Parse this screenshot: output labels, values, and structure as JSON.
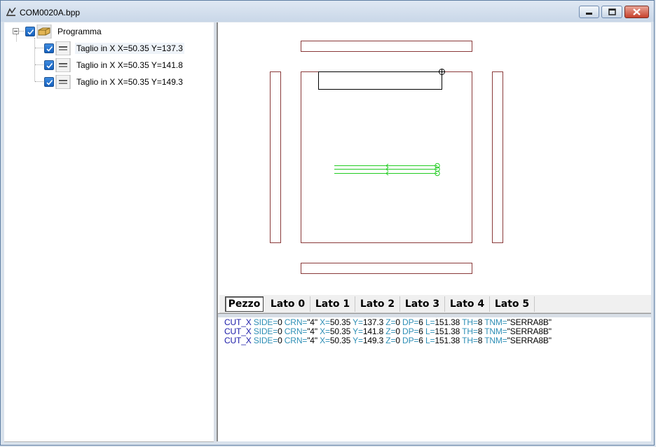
{
  "window": {
    "title": "COM0020A.bpp",
    "controls": [
      "minimize-button",
      "maximize-button",
      "close-button"
    ]
  },
  "tree": {
    "root": {
      "label": "Programma",
      "checked": true,
      "icon": "program-icon"
    },
    "children": [
      {
        "label": "Taglio in X X=50.35 Y=137.3",
        "checked": true,
        "icon": "cut-icon",
        "selected": true
      },
      {
        "label": "Taglio in X X=50.35 Y=141.8",
        "checked": true,
        "icon": "cut-icon",
        "selected": false
      },
      {
        "label": "Taglio in X X=50.35 Y=149.3",
        "checked": true,
        "icon": "cut-icon",
        "selected": false
      }
    ]
  },
  "tabs": [
    {
      "label": "Pezzo",
      "active": true
    },
    {
      "label": "Lato 0",
      "active": false
    },
    {
      "label": "Lato 1",
      "active": false
    },
    {
      "label": "Lato 2",
      "active": false
    },
    {
      "label": "Lato 3",
      "active": false
    },
    {
      "label": "Lato 4",
      "active": false
    },
    {
      "label": "Lato 5",
      "active": false
    }
  ],
  "code": [
    {
      "cmd": "CUT_X",
      "params": [
        [
          "SIDE=",
          "0"
        ],
        [
          "CRN=",
          "\"4\""
        ],
        [
          "X=",
          "50.35"
        ],
        [
          "Y=",
          "137.3"
        ],
        [
          "Z=",
          "0"
        ],
        [
          "DP=",
          "6"
        ],
        [
          "L=",
          "151.38"
        ],
        [
          "TH=",
          "8"
        ],
        [
          "TNM=",
          "\"SERRA8B\""
        ]
      ]
    },
    {
      "cmd": "CUT_X",
      "params": [
        [
          "SIDE=",
          "0"
        ],
        [
          "CRN=",
          "\"4\""
        ],
        [
          "X=",
          "50.35"
        ],
        [
          "Y=",
          "141.8"
        ],
        [
          "Z=",
          "0"
        ],
        [
          "DP=",
          "6"
        ],
        [
          "L=",
          "151.38"
        ],
        [
          "TH=",
          "8"
        ],
        [
          "TNM=",
          "\"SERRA8B\""
        ]
      ]
    },
    {
      "cmd": "CUT_X",
      "params": [
        [
          "SIDE=",
          "0"
        ],
        [
          "CRN=",
          "\"4\""
        ],
        [
          "X=",
          "50.35"
        ],
        [
          "Y=",
          "149.3"
        ],
        [
          "Z=",
          "0"
        ],
        [
          "DP=",
          "6"
        ],
        [
          "L=",
          "151.38"
        ],
        [
          "TH=",
          "8"
        ],
        [
          "TNM=",
          "\"SERRA8B\""
        ]
      ]
    }
  ],
  "colors": {
    "panel_outline": "#8a3a3a",
    "cut_lines": "#22cc22",
    "keyword": "#1a1aa8",
    "param": "#2e8fb6"
  }
}
